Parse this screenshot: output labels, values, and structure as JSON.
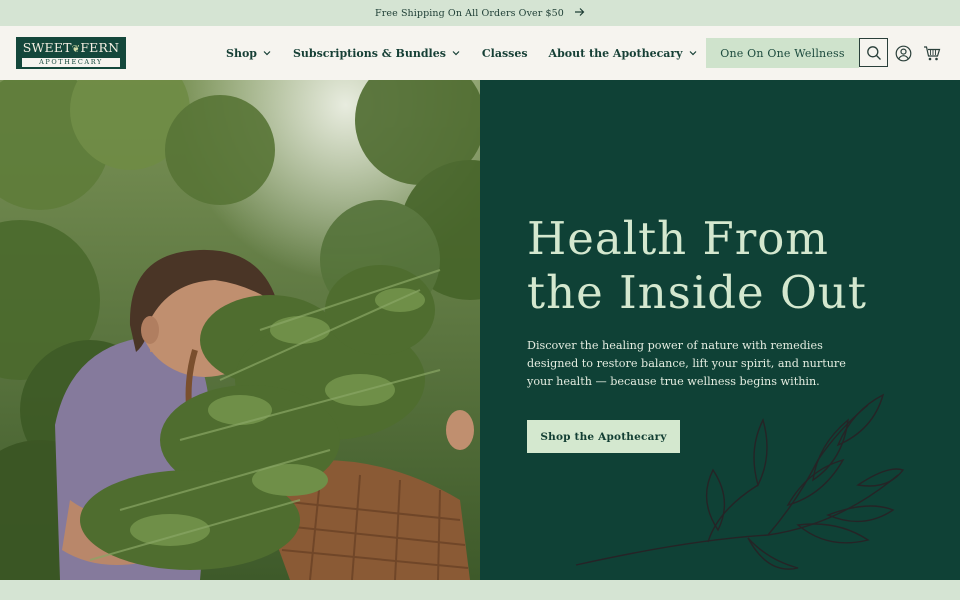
{
  "announcement": {
    "text": "Free Shipping On All Orders Over $50",
    "arrow_icon": "arrow-right-icon"
  },
  "header": {
    "logo": {
      "brand_top": "SWEET",
      "brand_mid": "FERN",
      "brand_bottom": "APOTHECARY"
    },
    "nav": [
      {
        "label": "Shop",
        "has_dropdown": true
      },
      {
        "label": "Subscriptions & Bundles",
        "has_dropdown": true
      },
      {
        "label": "Classes",
        "has_dropdown": false
      },
      {
        "label": "About the Apothecary",
        "has_dropdown": true
      }
    ],
    "wellness_label": "One On One Wellness",
    "icons": [
      "search-icon",
      "account-icon",
      "cart-icon"
    ]
  },
  "hero": {
    "title_line1": "Health From",
    "title_line2": "the Inside Out",
    "body": "Discover the healing power of nature with remedies designed to restore balance, lift your spirit, and nurture your health — because true wellness begins within.",
    "cta_label": "Shop the Apothecary"
  },
  "colors": {
    "panel": "#0f4136",
    "accent": "#d4e8cf",
    "band": "#d5e4d3",
    "logo": "#14473b"
  }
}
